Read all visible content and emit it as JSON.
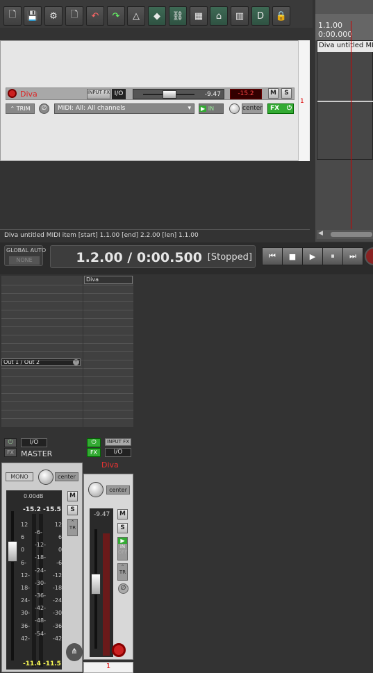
{
  "toolbar": {
    "buttons": [
      {
        "name": "new-project-icon",
        "glyph": "🗋"
      },
      {
        "name": "save-project-icon",
        "glyph": "💾"
      },
      {
        "name": "project-settings-icon",
        "glyph": "⚙"
      },
      {
        "name": "track-badge-icon",
        "glyph": "🗋"
      },
      {
        "name": "undo-icon",
        "glyph": "↶"
      },
      {
        "name": "redo-icon",
        "glyph": "↷"
      },
      {
        "name": "metronome-icon",
        "glyph": "△"
      },
      {
        "name": "ripple-edit-icon",
        "glyph": "◆"
      },
      {
        "name": "grouping-icon",
        "glyph": "⛓"
      },
      {
        "name": "grid-editing-icon",
        "glyph": "▦"
      },
      {
        "name": "envelope-icon",
        "glyph": "⌂"
      },
      {
        "name": "snap-icon",
        "glyph": "▥"
      },
      {
        "name": "loop-icon",
        "glyph": "D"
      },
      {
        "name": "lock-icon",
        "glyph": "🔒"
      }
    ]
  },
  "arrange": {
    "ruler_top": "1.1.00",
    "ruler_bottom": "0:00.000",
    "item_name": "Diva untitled MIDI"
  },
  "track": {
    "name": "Diva",
    "number": "1",
    "input_fx": "INPUT FX",
    "io": "I/O",
    "volume": "-9.47",
    "peak": "-15.2",
    "mute": "M",
    "solo": "S",
    "trim": "TRIM",
    "midi_input": "MIDI: All: All channels",
    "in": "IN",
    "pan": "center",
    "fx": "FX"
  },
  "status": {
    "text": "Diva untitled MIDI item [start] 1.1.00 [end] 2.2.00 [len] 1.1.00"
  },
  "transport": {
    "global_auto": "GLOBAL AUTO",
    "none": "NONE",
    "time": "1.2.00 / 0:00.500",
    "state": "[Stopped]"
  },
  "mixer": {
    "master": {
      "out": "Out 1 / Out 2",
      "io": "I/O",
      "fx": "FX",
      "name": "MASTER",
      "mono": "MONO",
      "pan": "center",
      "gain": "0.00dB",
      "peak_l": "-15.2",
      "peak_r": "-15.5",
      "m": "M",
      "s": "S",
      "tr": "TR",
      "rms_l": "-11.4",
      "rms_r": "-11.5",
      "scale_left": [
        "12",
        "6",
        "0",
        "6-",
        "12-",
        "18-",
        "24-",
        "30-",
        "36-",
        "42-"
      ],
      "scale_mid": [
        "-6-",
        "-12-",
        "-18-",
        "-24-",
        "-30-",
        "-36-",
        "-42-",
        "-48-",
        "-54-"
      ],
      "scale_right": [
        "12",
        "6",
        "0",
        "-6",
        "-12",
        "-18",
        "-24",
        "-30",
        "-36",
        "-42"
      ]
    },
    "diva": {
      "name_top": "Diva",
      "input_fx": "INPUT FX",
      "io": "I/O",
      "fx": "FX",
      "name": "Diva",
      "pan": "center",
      "volume": "-9.47",
      "m": "M",
      "s": "S",
      "in": "IN",
      "off": "OFF",
      "tr": "TR",
      "number": "1"
    }
  }
}
